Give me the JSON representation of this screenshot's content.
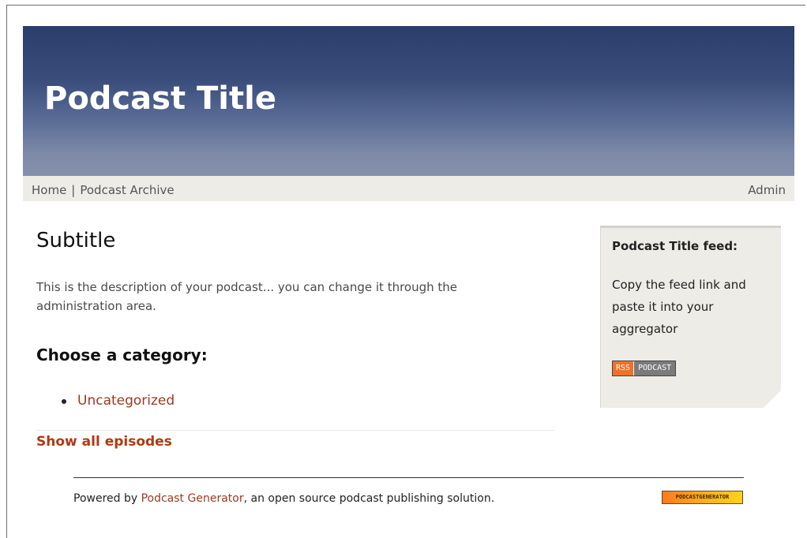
{
  "header": {
    "title": "Podcast Title"
  },
  "nav": {
    "home": "Home",
    "separator": "|",
    "archive": "Podcast Archive",
    "admin": "Admin"
  },
  "main": {
    "subtitle": "Subtitle",
    "description": "This is the description of your podcast... you can change it through the administration area.",
    "category_heading": "Choose a category:",
    "categories": [
      "Uncategorized"
    ],
    "show_all": "Show all episodes"
  },
  "sidebar": {
    "title": "Podcast Title feed:",
    "text": "Copy the feed link and paste it into your aggregator",
    "rss_label": "RSS",
    "podcast_label": "PODCAST"
  },
  "footer": {
    "prefix": "Powered by ",
    "link": "Podcast Generator",
    "suffix": ", an open source podcast publishing solution.",
    "badge": "PODCASTGENERATOR"
  },
  "colors": {
    "header_top": "#2b3d6b",
    "header_bottom": "#8690ac",
    "link": "#9a3a1f",
    "show_all": "#b03a10",
    "panel_bg": "#eeece6"
  }
}
